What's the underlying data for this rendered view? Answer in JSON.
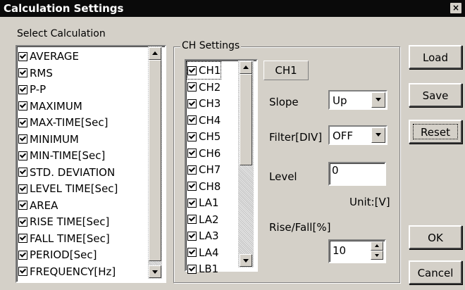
{
  "window": {
    "title": "Calculation Settings",
    "close_glyph": "×"
  },
  "select_calc": {
    "label": "Select Calculation",
    "items": [
      {
        "label": "AVERAGE",
        "checked": true
      },
      {
        "label": "RMS",
        "checked": true
      },
      {
        "label": "P-P",
        "checked": true
      },
      {
        "label": "MAXIMUM",
        "checked": true
      },
      {
        "label": "MAX-TIME[Sec]",
        "checked": true
      },
      {
        "label": "MINIMUM",
        "checked": true
      },
      {
        "label": "MIN-TIME[Sec]",
        "checked": true
      },
      {
        "label": "STD. DEVIATION",
        "checked": true
      },
      {
        "label": "LEVEL TIME[Sec]",
        "checked": true
      },
      {
        "label": "AREA",
        "checked": true
      },
      {
        "label": "RISE TIME[Sec]",
        "checked": true
      },
      {
        "label": "FALL TIME[Sec]",
        "checked": true
      },
      {
        "label": "PERIOD[Sec]",
        "checked": true
      },
      {
        "label": "FREQUENCY[Hz]",
        "checked": true
      }
    ]
  },
  "ch_settings": {
    "label": "CH Settings",
    "channels": [
      {
        "label": "CH1",
        "checked": true
      },
      {
        "label": "CH2",
        "checked": true
      },
      {
        "label": "CH3",
        "checked": true
      },
      {
        "label": "CH4",
        "checked": true
      },
      {
        "label": "CH5",
        "checked": true
      },
      {
        "label": "CH6",
        "checked": true
      },
      {
        "label": "CH7",
        "checked": true
      },
      {
        "label": "CH8",
        "checked": true
      },
      {
        "label": "LA1",
        "checked": true
      },
      {
        "label": "LA2",
        "checked": true
      },
      {
        "label": "LA3",
        "checked": true
      },
      {
        "label": "LA4",
        "checked": true
      },
      {
        "label": "LB1",
        "checked": true
      }
    ],
    "selected_channel": "CH1",
    "slope": {
      "label": "Slope",
      "value": "Up"
    },
    "filter": {
      "label": "Filter[DIV]",
      "value": "OFF"
    },
    "level": {
      "label": "Level",
      "value": "0"
    },
    "unit": "Unit:[V]",
    "rise_fall": {
      "label": "Rise/Fall[%]",
      "value": "10"
    }
  },
  "buttons": {
    "load": "Load",
    "save": "Save",
    "reset": "Reset",
    "ok": "OK",
    "cancel": "Cancel"
  }
}
